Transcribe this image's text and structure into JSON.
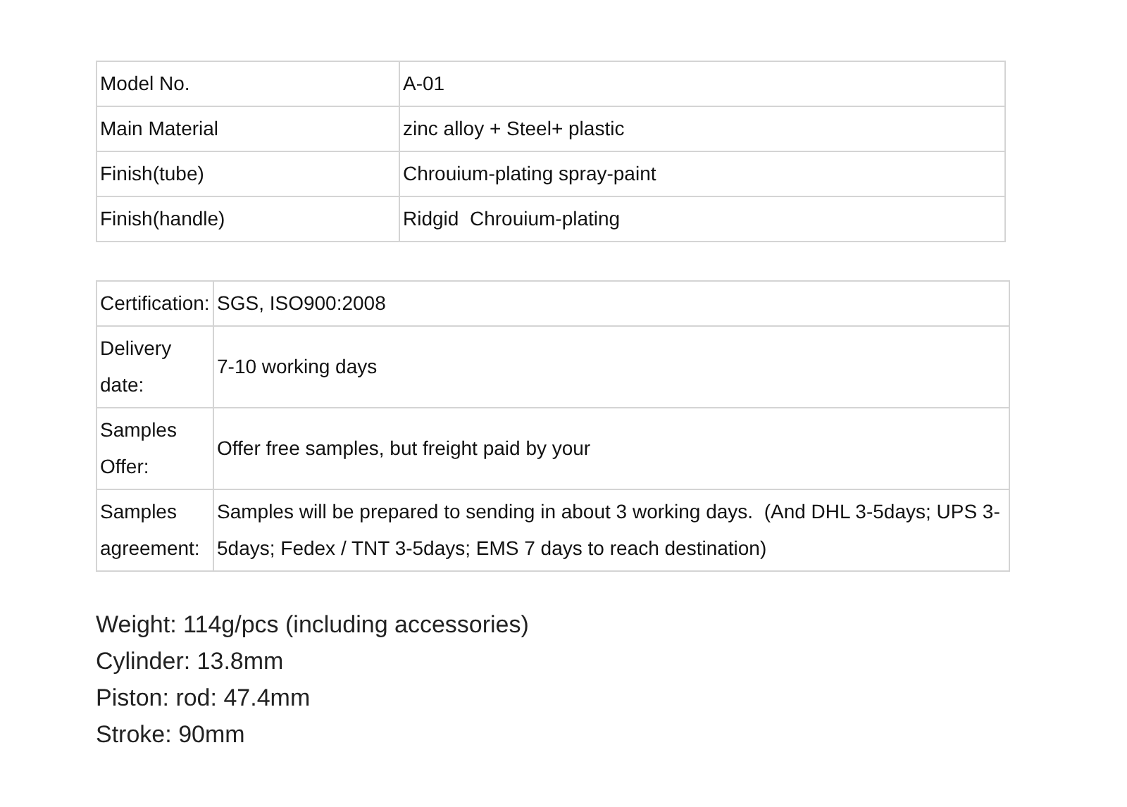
{
  "product_table": {
    "rows": [
      {
        "label": "Model No.",
        "value": "A-01"
      },
      {
        "label": "Main Material",
        "value": "zinc alloy + Steel+ plastic"
      },
      {
        "label": "Finish(tube)",
        "value": "Chrouium-plating spray-paint"
      },
      {
        "label": "Finish(handle)",
        "value": "Ridgid  Chrouium-plating"
      }
    ]
  },
  "terms_table": {
    "rows": [
      {
        "label": "Certification:",
        "value": "SGS, ISO900:2008"
      },
      {
        "label": "Delivery date:",
        "value": "7-10 working days"
      },
      {
        "label": "Samples Offer:",
        "value": "Offer free samples, but freight paid by your"
      },
      {
        "label": "Samples agreement:",
        "value": "Samples will be prepared to sending in about 3 working days.  (And DHL 3-5days; UPS 3-5days; Fedex / TNT 3-5days; EMS 7 days to reach destination)"
      }
    ]
  },
  "specs": [
    "Weight: 114g/pcs (including accessories)",
    "Cylinder: 13.8mm",
    "Piston: rod: 47.4mm",
    "Stroke: 90mm"
  ]
}
